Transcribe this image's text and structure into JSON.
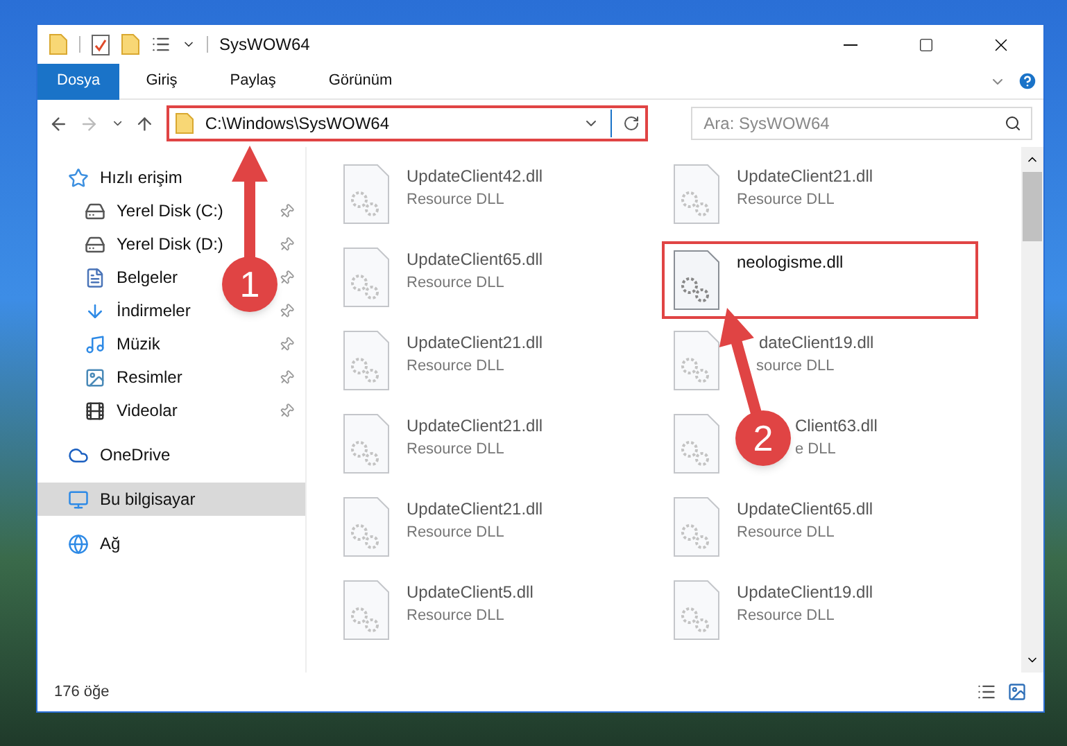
{
  "window": {
    "title": "SysWOW64"
  },
  "ribbon_tabs": [
    {
      "label": "Dosya",
      "selected": true
    },
    {
      "label": "Giriş",
      "selected": false
    },
    {
      "label": "Paylaş",
      "selected": false
    },
    {
      "label": "Görünüm",
      "selected": false
    }
  ],
  "address": {
    "path": "C:\\Windows\\SysWOW64",
    "highlighted": true
  },
  "search": {
    "placeholder": "Ara: SysWOW64"
  },
  "sidebar": {
    "items": [
      {
        "label": "Hızlı erişim",
        "selected": false,
        "children": [
          {
            "label": "Yerel Disk (C:)",
            "pinned": true
          },
          {
            "label": "Yerel Disk (D:)",
            "pinned": true
          },
          {
            "label": "Belgeler",
            "pinned": true
          },
          {
            "label": "İndirmeler",
            "pinned": true
          },
          {
            "label": "Müzik",
            "pinned": true
          },
          {
            "label": "Resimler",
            "pinned": true
          },
          {
            "label": "Videolar",
            "pinned": true
          }
        ]
      },
      {
        "label": "OneDrive",
        "selected": false
      },
      {
        "label": "Bu bilgisayar",
        "selected": true
      },
      {
        "label": "Ağ",
        "selected": false
      }
    ]
  },
  "files": [
    {
      "name": "UpdateClient42.dll",
      "type": "Resource DLL",
      "highlighted": false
    },
    {
      "name": "UpdateClient21.dll",
      "type": "Resource DLL",
      "highlighted": false
    },
    {
      "name": "UpdateClient65.dll",
      "type": "Resource DLL",
      "highlighted": false
    },
    {
      "name": "neologisme.dll",
      "highlighted": true
    },
    {
      "name": "UpdateClient21.dll",
      "type": "Resource DLL",
      "highlighted": false
    },
    {
      "name": "dateClient19.dll",
      "type": "source DLL",
      "highlighted": false
    },
    {
      "name": "UpdateClient21.dll",
      "type": "Resource DLL",
      "highlighted": false
    },
    {
      "name": "Client63.dll",
      "type": "e DLL",
      "highlighted": false
    },
    {
      "name": "UpdateClient21.dll",
      "type": "Resource DLL",
      "highlighted": false
    },
    {
      "name": "UpdateClient65.dll",
      "type": "Resource DLL",
      "highlighted": false
    },
    {
      "name": "UpdateClient5.dll",
      "type": "Resource DLL",
      "highlighted": false
    },
    {
      "name": "UpdateClient19.dll",
      "type": "Resource DLL",
      "highlighted": false
    }
  ],
  "annotations": [
    {
      "label": "1"
    },
    {
      "label": "2"
    }
  ],
  "status_bar": {
    "count": "176 öğe"
  }
}
